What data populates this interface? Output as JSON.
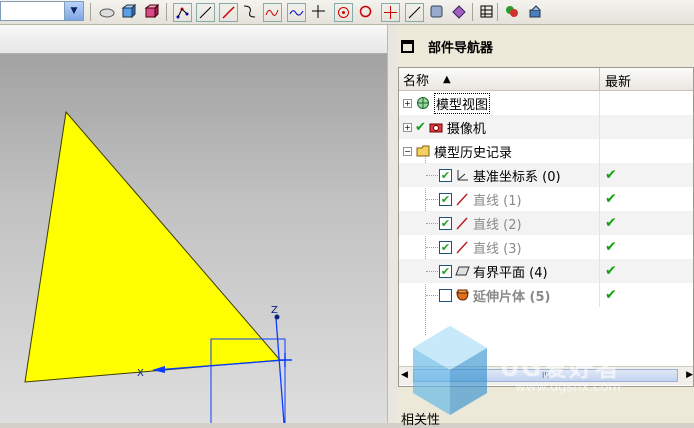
{
  "toolbar": {
    "combo_value": "",
    "icons": [
      "open-cube-icon",
      "shaded-cube-icon",
      "pink-cube-icon",
      "point-set-icon",
      "line-icon",
      "red-line-icon",
      "arc-icon",
      "spline-icon",
      "curve-icon",
      "axis-icon",
      "circle-point-icon",
      "circle-icon",
      "cross-icon",
      "line-tool-icon",
      "sketch-icon",
      "feature-icon",
      "table-icon",
      "paint-icon",
      "render-icon"
    ]
  },
  "viewport": {
    "axis_z": "Z",
    "axis_x": "X",
    "shape_color": "#ffff00"
  },
  "navigator": {
    "title": "部件导航器",
    "columns": {
      "name": "名称",
      "latest": "最新"
    },
    "rows": [
      {
        "label": "模型视图",
        "latest": ""
      },
      {
        "label": "摄像机",
        "latest": ""
      },
      {
        "label": "模型历史记录",
        "latest": ""
      },
      {
        "label": "基准坐标系 (0)",
        "latest": "✔"
      },
      {
        "label": "直线 (1)",
        "latest": "✔"
      },
      {
        "label": "直线 (2)",
        "latest": "✔"
      },
      {
        "label": "直线 (3)",
        "latest": "✔"
      },
      {
        "label": "有界平面 (4)",
        "latest": "✔"
      },
      {
        "label": "延伸片体 (5)",
        "latest": "✔"
      }
    ],
    "scroll_thumb": "III",
    "related": "相关性"
  },
  "watermark": {
    "text": "UG爱好者",
    "url": "www.ugsnx.com"
  },
  "colors": {
    "check_green": "#16a016",
    "accent_blue": "#0a3cff"
  }
}
